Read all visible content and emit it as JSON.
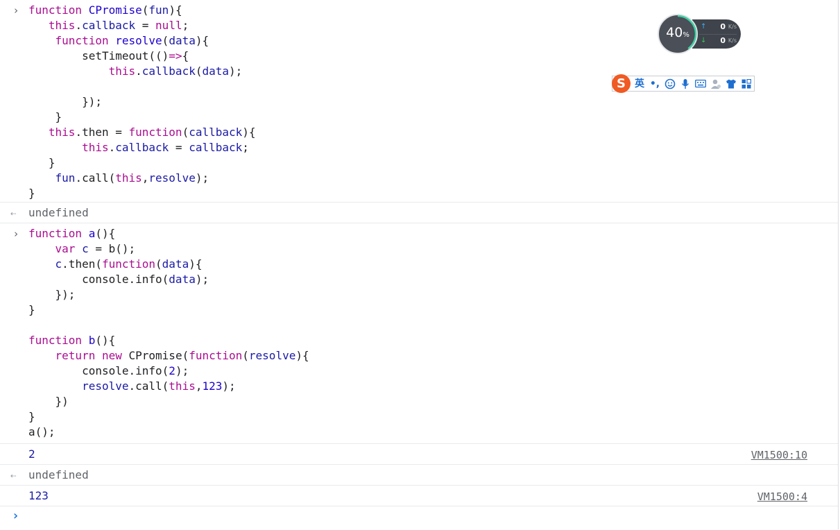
{
  "console": {
    "block1_code_lines": [
      "function CPromise(fun){",
      "   this.callback = null;",
      "    function resolve(data){",
      "        setTimeout(()=>{",
      "            this.callback(data);",
      "",
      "        });",
      "    }",
      "   this.then = function(callback){",
      "        this.callback = callback;",
      "   }",
      "    fun.call(this,resolve);",
      "}"
    ],
    "result1": "undefined",
    "block2_code_lines": [
      "function a(){",
      "    var c = b();",
      "    c.then(function(data){",
      "        console.info(data);",
      "    });",
      "}",
      "",
      "function b(){",
      "    return new CPromise(function(resolve){",
      "        console.info(2);",
      "        resolve.call(this,123);",
      "    })",
      "}",
      "a();"
    ],
    "output_2": {
      "value": "2",
      "source": "VM1500:10"
    },
    "result2": "undefined",
    "output_123": {
      "value": "123",
      "source": "VM1500:4"
    }
  },
  "netmeter": {
    "cpu_value": "40",
    "cpu_unit": "%",
    "cpu_fraction": 0.4,
    "upload": {
      "value": "0",
      "unit": "K/s"
    },
    "download": {
      "value": "0",
      "unit": "K/s"
    }
  },
  "ime_toolbar": {
    "logo": "S",
    "lang": "英",
    "punct": "•,",
    "items": [
      "emoji-icon",
      "microphone-icon",
      "keyboard-icon",
      "user-icon",
      "skin-shirt-icon",
      "grid-icon"
    ]
  },
  "colors": {
    "keyword": "#aa0d91",
    "function_name": "#1c00cf",
    "output_value": "#1a1aa6",
    "input_caret": "#1a73e8",
    "ime_logo": "#f05a23"
  }
}
